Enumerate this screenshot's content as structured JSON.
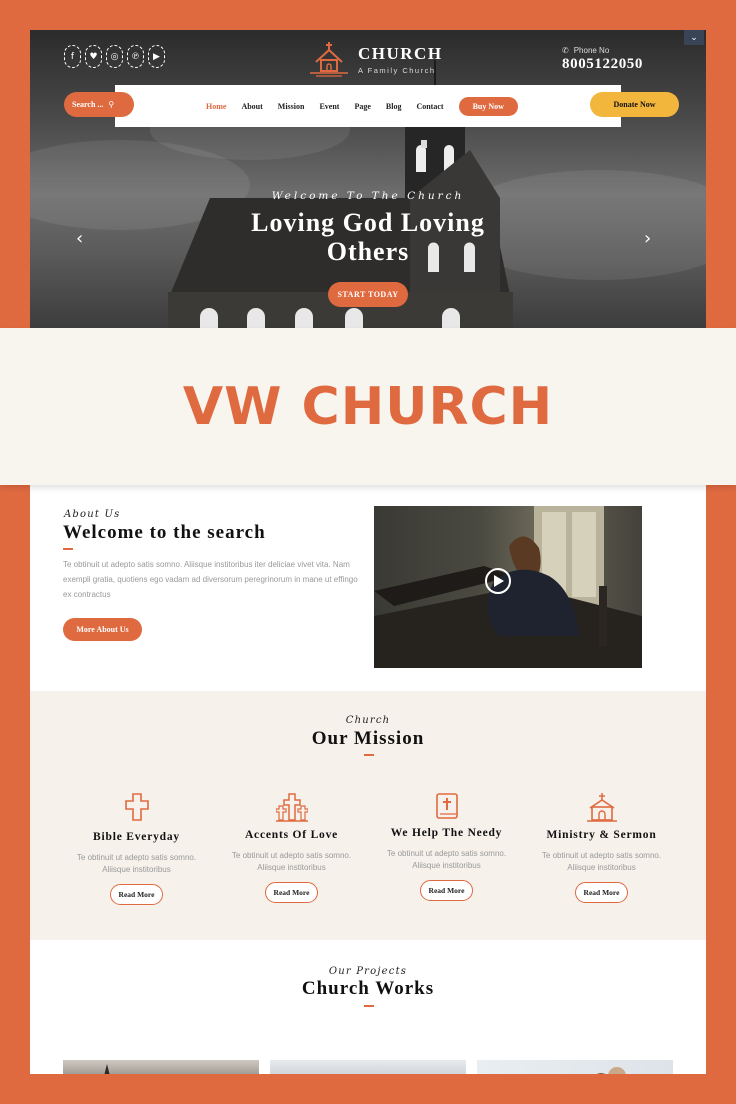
{
  "hero": {
    "socials": [
      "f",
      "t",
      "ig",
      "p",
      "yt"
    ],
    "social_icons": [
      "facebook-icon",
      "twitter-icon",
      "instagram-icon",
      "pinterest-icon",
      "youtube-icon"
    ],
    "logo": {
      "name": "CHURCH",
      "tagline": "A Family Church"
    },
    "phone": {
      "label": "Phone No",
      "number": "8005122050"
    },
    "search_label": "Search ...",
    "nav": [
      "Home",
      "About",
      "Mission",
      "Event",
      "Page",
      "Blog",
      "Contact"
    ],
    "active_nav": "Home",
    "buy_label": "Buy Now",
    "donate_label": "Donate Now",
    "subtitle": "Welcome To The Church",
    "title": "Loving God Loving Others",
    "cta_label": "START TODAY"
  },
  "banner": {
    "title": "VW CHURCH"
  },
  "about": {
    "kicker": "About Us",
    "title": "Welcome to the search",
    "text": "Te obtinuit ut adepto satis somno. Aliisque institoribus iter deliciae vivet vita. Nam exempli gratia, quotiens ego vadam ad diversorum peregrinorum in mane ut effingo ex contractus",
    "button": "More About Us"
  },
  "mission": {
    "kicker": "Church",
    "title": "Our Mission",
    "cards": [
      {
        "title": "Bible Everyday",
        "text": "Te obtinuit ut adepto satis somno. Aliisque institoribus",
        "button": "Read More",
        "icon": "cross-icon"
      },
      {
        "title": "Accents Of Love",
        "text": "Te obtinuit ut adepto satis somno. Aliisque institoribus",
        "button": "Read More",
        "icon": "crosses-icon"
      },
      {
        "title": "We Help The Needy",
        "text": "Te obtinuit ut adepto satis somno. Aliisque institoribus",
        "button": "Read More",
        "icon": "bible-icon"
      },
      {
        "title": "Ministry & Sermon",
        "text": "Te obtinuit ut adepto satis somno. Aliisque institoribus",
        "button": "Read More",
        "icon": "church-icon"
      }
    ]
  },
  "works": {
    "kicker": "Our Projects",
    "title": "Church Works"
  },
  "colors": {
    "accent": "#e06a40",
    "donate": "#f2b63c",
    "cream": "#f6f1eb"
  }
}
